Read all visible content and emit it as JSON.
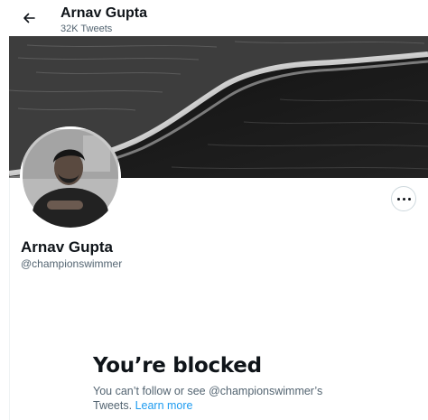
{
  "header": {
    "title": "Arnav Gupta",
    "tweet_count": "32K Tweets"
  },
  "profile": {
    "display_name": "Arnav Gupta",
    "handle": "@championswimmer"
  },
  "blocked": {
    "title": "You’re blocked",
    "message": "You can’t follow or see @championswimmer’s Tweets.",
    "learn_more": "Learn more"
  },
  "icons": {
    "back": "arrow-left-icon",
    "more": "more-horizontal-icon"
  },
  "colors": {
    "accent": "#1d9bf0",
    "text_primary": "#0f1419",
    "text_secondary": "#536471",
    "border": "#cfd9de"
  }
}
